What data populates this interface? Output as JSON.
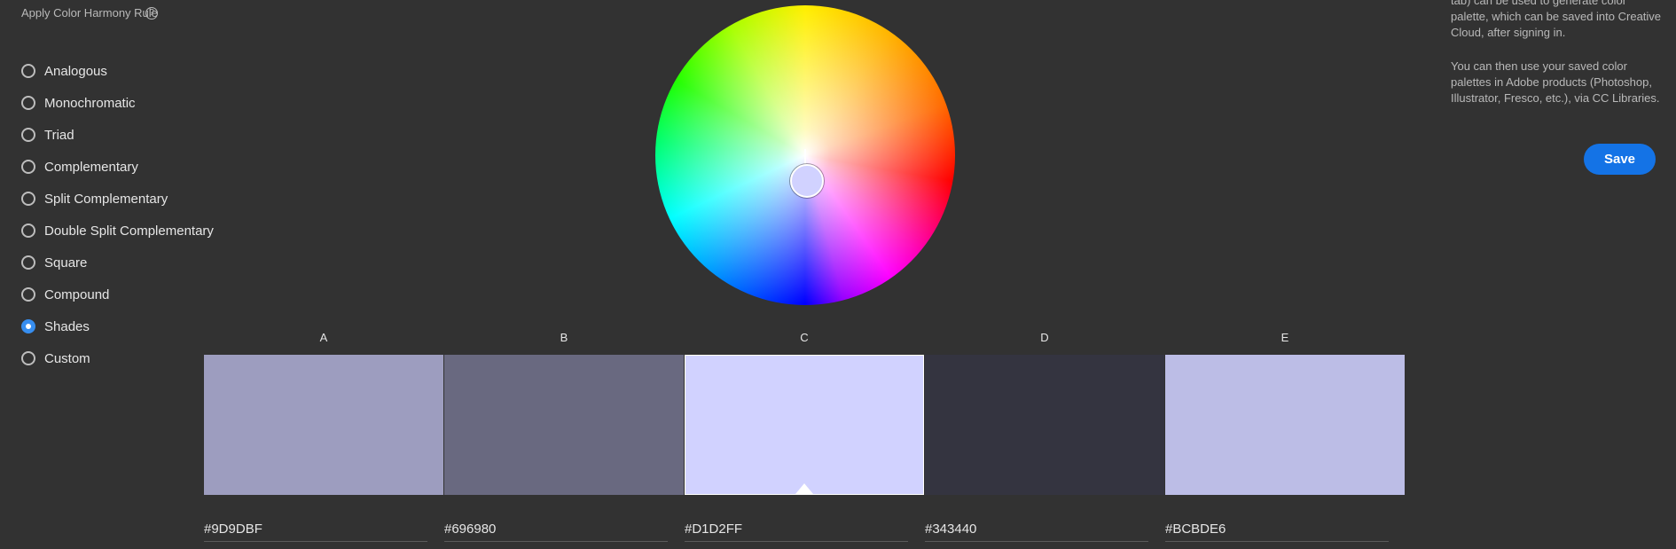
{
  "harmony": {
    "title": "Apply Color Harmony Rule",
    "help_icon": "?",
    "rules": [
      {
        "label": "Analogous",
        "selected": false
      },
      {
        "label": "Monochromatic",
        "selected": false
      },
      {
        "label": "Triad",
        "selected": false
      },
      {
        "label": "Complementary",
        "selected": false
      },
      {
        "label": "Split Complementary",
        "selected": false
      },
      {
        "label": "Double Split Complementary",
        "selected": false
      },
      {
        "label": "Square",
        "selected": false
      },
      {
        "label": "Compound",
        "selected": false
      },
      {
        "label": "Shades",
        "selected": true
      },
      {
        "label": "Custom",
        "selected": false
      }
    ]
  },
  "wheel": {
    "handle_color": "#d1d2ff"
  },
  "palette": {
    "selected_index": 2,
    "swatches": [
      {
        "label": "A",
        "hex": "#9D9DBF",
        "color": "#9d9dbf"
      },
      {
        "label": "B",
        "hex": "#696980",
        "color": "#696980"
      },
      {
        "label": "C",
        "hex": "#D1D2FF",
        "color": "#d1d2ff"
      },
      {
        "label": "D",
        "hex": "#343440",
        "color": "#343440"
      },
      {
        "label": "E",
        "hex": "#BCBDE6",
        "color": "#bcbde6"
      }
    ]
  },
  "info": {
    "paragraph1": "tab) can be used to generate color palette, which can be saved into Creative Cloud, after signing in.",
    "paragraph2": "You can then use your saved color palettes in Adobe products (Photoshop, Illustrator, Fresco, etc.), via CC Libraries.",
    "save_label": "Save"
  },
  "colors": {
    "background": "#323232",
    "accent": "#1473e6",
    "radio_selected": "#378ef0"
  }
}
